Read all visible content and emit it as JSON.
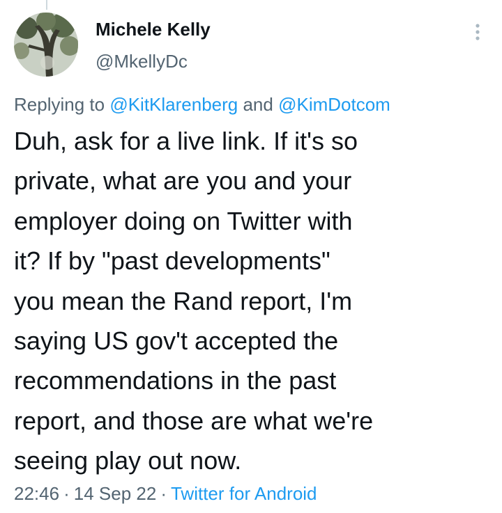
{
  "author": {
    "name": "Michele Kelly",
    "handle": "@MkellyDc"
  },
  "reply": {
    "prefix": "Replying to ",
    "mention_1": "@KitKlarenberg",
    "conjunction": " and ",
    "mention_2": "@KimDotcom"
  },
  "tweet": {
    "lines": [
      "Duh, ask for a live link. If it's so",
      "private, what are you and your",
      "employer doing on Twitter with",
      "it? If by \"past developments\"",
      "you mean the Rand report, I'm",
      "saying US gov't accepted the",
      "recommendations in the past",
      "report, and those are what we're",
      "seeing play out now."
    ]
  },
  "meta": {
    "time": "22:46",
    "separator": "·",
    "date": "14 Sep 22",
    "source": "Twitter for Android"
  },
  "icons": {
    "more": "more-vertical-icon"
  },
  "colors": {
    "text": "#0f1419",
    "secondary": "#536471",
    "link": "#1d9bf0",
    "background": "#ffffff"
  }
}
